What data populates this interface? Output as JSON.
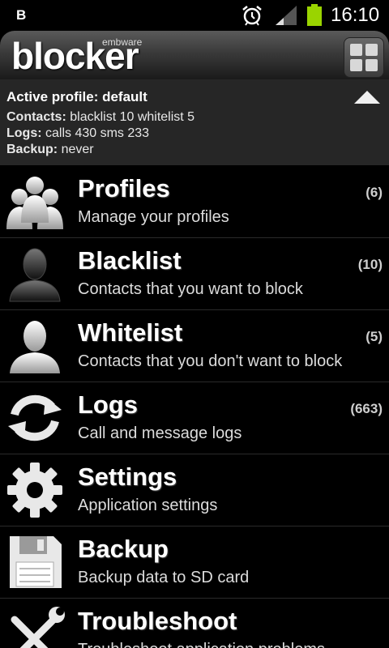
{
  "status_bar": {
    "left_text": "B",
    "time": "16:10",
    "icons": [
      "alarm-icon",
      "signal-icon",
      "battery-icon"
    ],
    "battery_color": "#9ad400"
  },
  "header": {
    "brand_small": "embware",
    "title": "blocker"
  },
  "profile": {
    "active_label": "Active profile:",
    "active_value": "default",
    "contacts_label": "Contacts:",
    "contacts_value": "blacklist 10 whitelist 5",
    "logs_label": "Logs:",
    "logs_value": "calls 430 sms 233",
    "backup_label": "Backup:",
    "backup_value": "never"
  },
  "menu": [
    {
      "title": "Profiles",
      "subtitle": "Manage your profiles",
      "count": "(6)",
      "icon": "profiles-icon"
    },
    {
      "title": "Blacklist",
      "subtitle": "Contacts that you want to block",
      "count": "(10)",
      "icon": "blacklist-icon"
    },
    {
      "title": "Whitelist",
      "subtitle": "Contacts that you don't want to block",
      "count": "(5)",
      "icon": "whitelist-icon"
    },
    {
      "title": "Logs",
      "subtitle": "Call and message logs",
      "count": "(663)",
      "icon": "logs-icon"
    },
    {
      "title": "Settings",
      "subtitle": "Application settings",
      "count": "",
      "icon": "settings-icon"
    },
    {
      "title": "Backup",
      "subtitle": "Backup data to SD card",
      "count": "",
      "icon": "backup-icon"
    },
    {
      "title": "Troubleshoot",
      "subtitle": "Troubleshoot application problems",
      "count": "",
      "icon": "troubleshoot-icon"
    }
  ]
}
